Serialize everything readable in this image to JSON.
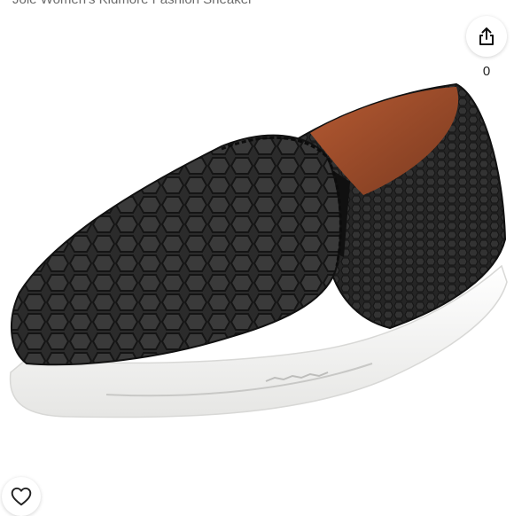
{
  "listing": {
    "title": "Joie Women's Kidmore Fashion Sneaker"
  },
  "image": {
    "subject": "black snake-embossed leather slip-on sneaker",
    "colors": {
      "leather": "#2a2a2a",
      "sole": "#f4f4f2",
      "lining": "#9a4a2a"
    }
  },
  "share": {
    "icon": "share-icon",
    "count": "0"
  },
  "like": {
    "icon": "heart-icon"
  }
}
